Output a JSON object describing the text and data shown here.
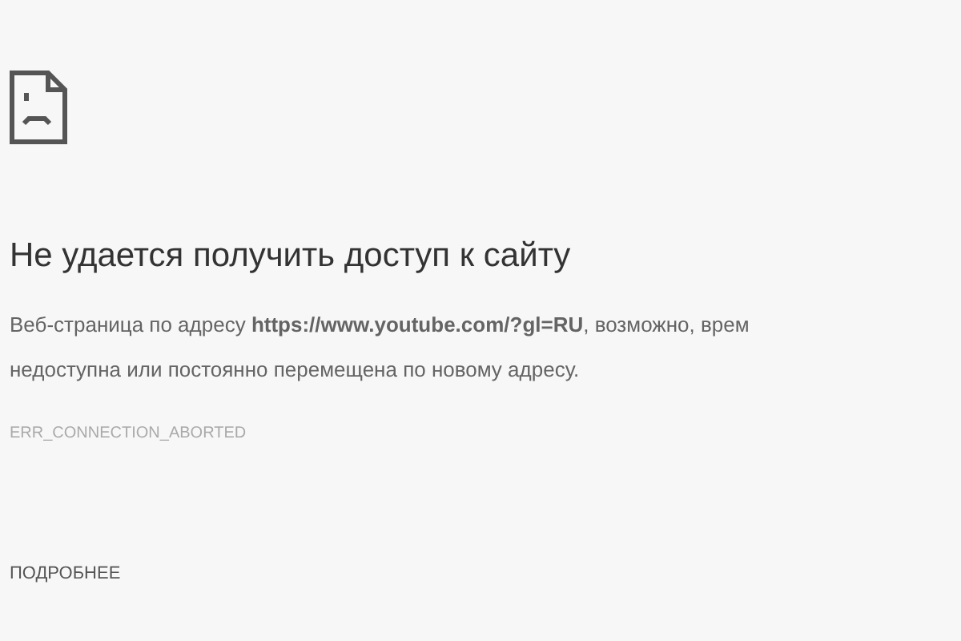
{
  "heading": "Не удается получить доступ к сайту",
  "message_lines": [
    "Веб-страница по адресу **https://www.youtube.com/?gl=RU**, возможно, врем",
    "недоступна или постоянно перемещена по новому адресу."
  ],
  "error_code": "ERR_CONNECTION_ABORTED",
  "details_button": "ПОДРОБНЕЕ"
}
